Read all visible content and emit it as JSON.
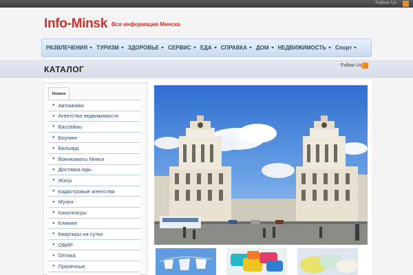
{
  "topbar": {
    "follow": "Follow Us"
  },
  "site": {
    "logo": "Info-Minsk",
    "tagline": "Вся информация Минска"
  },
  "nav": [
    {
      "label": "РАЗВЛЕЧЕНИЯ"
    },
    {
      "label": "ТУРИЗМ"
    },
    {
      "label": "ЗДОРОВЬЕ"
    },
    {
      "label": "СЕРВИС"
    },
    {
      "label": "ЕДА"
    },
    {
      "label": "СПРАВКА"
    },
    {
      "label": "ДОМ"
    },
    {
      "label": "НЕДВИЖИМОСТЬ"
    },
    {
      "label": "Спорт"
    }
  ],
  "page": {
    "title": "КАТАЛОГ",
    "follow": "Follow Us"
  },
  "sidebar": {
    "tab": "Новое",
    "items": [
      "Автомойки",
      "Агентства недвижимости",
      "Бассейны",
      "Боулинг",
      "Бильярд",
      "Военкоматы Минск",
      "Доставка еды",
      "Жэсы",
      "Кадастровые агентства",
      "Музеи",
      "Кинотеатры",
      "Клининг",
      "Квартиры на сутки",
      "ОВИР",
      "Оптика",
      "Прачечные"
    ]
  },
  "colors": {
    "brand": "#c8322a",
    "nav_text": "#334a6a",
    "link": "#2a4a6f",
    "rss": "#f28b1e"
  },
  "icons": {
    "rss": "rss-icon",
    "bullet": "bullet-icon",
    "caret": "chevron-down-icon"
  }
}
